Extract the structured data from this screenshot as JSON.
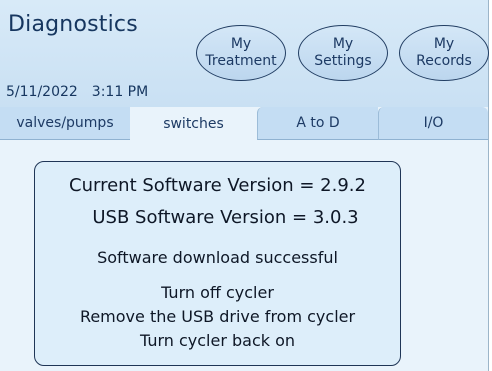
{
  "header": {
    "title": "Diagnostics",
    "date": "5/11/2022",
    "time": "3:11 PM",
    "buttons": [
      {
        "line1": "My",
        "line2": "Treatment"
      },
      {
        "line1": "My",
        "line2": "Settings"
      },
      {
        "line1": "My",
        "line2": "Records"
      }
    ]
  },
  "tabs": [
    {
      "label": "valves/pumps"
    },
    {
      "label": "switches"
    },
    {
      "label": "A to D"
    },
    {
      "label": "I/O"
    }
  ],
  "dialog": {
    "current_version": "Current Software Version = 2.9.2",
    "usb_version": "USB Software Version = 3.0.3",
    "status": "Software download successful",
    "instructions": [
      "Turn off cycler",
      "Remove the USB drive from cycler",
      "Turn cycler back on"
    ]
  },
  "colors": {
    "header_bg": "#c9e0f3",
    "content_bg": "#e9f3fb",
    "text_dark": "#16365f",
    "dialog_border": "#1f3556"
  }
}
